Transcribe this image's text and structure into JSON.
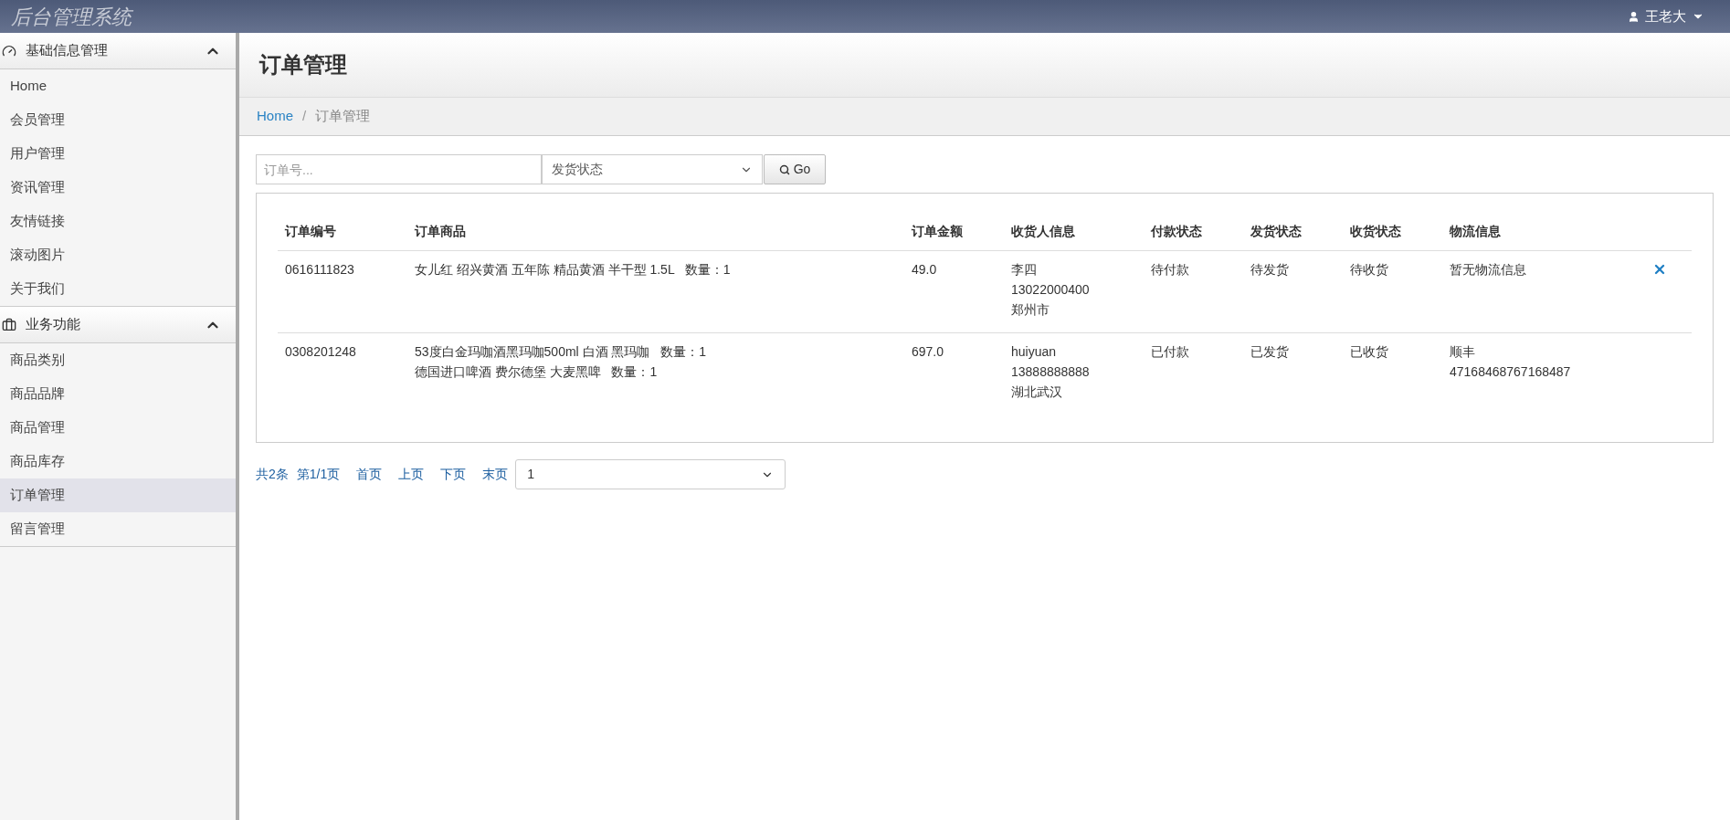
{
  "app_title": "后台管理系统",
  "user": {
    "name": "王老大"
  },
  "sidebar": {
    "sections": [
      {
        "title": "基础信息管理",
        "expanded": true,
        "items": [
          {
            "label": "Home",
            "selected": false
          },
          {
            "label": "会员管理",
            "selected": false
          },
          {
            "label": "用户管理",
            "selected": false
          },
          {
            "label": "资讯管理",
            "selected": false
          },
          {
            "label": "友情链接",
            "selected": false
          },
          {
            "label": "滚动图片",
            "selected": false
          },
          {
            "label": "关于我们",
            "selected": false
          }
        ]
      },
      {
        "title": "业务功能",
        "expanded": true,
        "items": [
          {
            "label": "商品类别",
            "selected": false
          },
          {
            "label": "商品品牌",
            "selected": false
          },
          {
            "label": "商品管理",
            "selected": false
          },
          {
            "label": "商品库存",
            "selected": false
          },
          {
            "label": "订单管理",
            "selected": true
          },
          {
            "label": "留言管理",
            "selected": false
          }
        ]
      }
    ]
  },
  "page_title": "订单管理",
  "breadcrumb": [
    "Home",
    "订单管理"
  ],
  "breadcrumb_separator": "/",
  "filters": {
    "order_no": {
      "placeholder": "订单号..."
    },
    "status_select": {
      "value": "发货状态"
    },
    "go_button": "Go"
  },
  "table": {
    "columns": [
      "订单编号",
      "订单商品",
      "订单金额",
      "收货人信息",
      "付款状态",
      "发货状态",
      "收货状态",
      "物流信息"
    ],
    "rows": [
      {
        "order_no": "0616111823",
        "items": [
          "女儿红 绍兴黄酒 五年陈 精品黄酒 半干型 1.5L   数量：1"
        ],
        "amount": "49.0",
        "receiver": [
          "李四",
          "13022000400",
          "郑州市"
        ],
        "payment": "待付款",
        "shipping": "待发货",
        "receipt": "待收货",
        "logistics": [
          "暂无物流信息"
        ],
        "deletable": true
      },
      {
        "order_no": "0308201248",
        "items": [
          "53度白金玛咖酒黑玛咖500ml 白酒 黑玛咖   数量：1",
          "德国进口啤酒 费尔德堡 大麦黑啤   数量：1"
        ],
        "amount": "697.0",
        "receiver": [
          "huiyuan",
          "13888888888",
          "湖北武汉"
        ],
        "payment": "已付款",
        "shipping": "已发货",
        "receipt": "已收货",
        "logistics": [
          "顺丰",
          "47168468767168487"
        ],
        "deletable": false
      }
    ]
  },
  "pagination": {
    "links": [
      "共2条",
      "第1/1页",
      "首页",
      "上页",
      "下页",
      "末页"
    ],
    "page_select": "1"
  }
}
